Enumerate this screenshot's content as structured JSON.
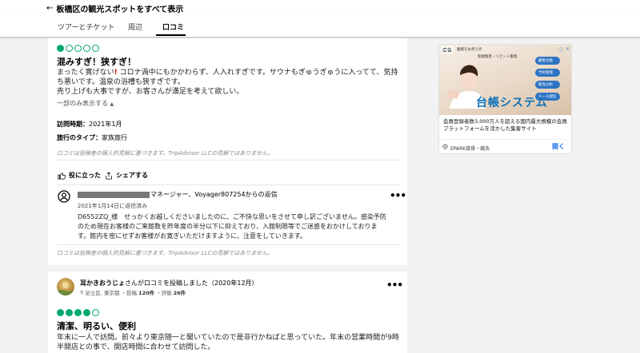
{
  "header": {
    "back_label": "板橋区の観光スポットをすべて表示"
  },
  "tabs": [
    {
      "label": "ツアーとチケット",
      "active": false
    },
    {
      "label": "周辺",
      "active": false
    },
    {
      "label": "口コミ",
      "active": true
    }
  ],
  "review1": {
    "rating": 1,
    "title": "混みすぎ！狭すぎ！",
    "body_lines": [
      "まったく寛げない",
      "コロナ渦中にもかかわらず、人入れすぎです。サウナもぎゅうぎゅうに入ってて、気持",
      "ち悪いです。温泉の浴槽も狭すぎです。",
      "売り上げも大事ですが、お客さんが満足を考えて欲しい。"
    ],
    "show_less": "一部のみ表示する",
    "visit_label": "訪問時期：",
    "visit_value": "2021年1月",
    "trip_label": "旅行のタイプ：",
    "trip_value": "家族旅行",
    "disclaimer": "口コミは投稿者の個人的見解に基づきます。TripAdvisor LLCの見解ではありません。",
    "helpful": "役に立った",
    "share": "シェアする"
  },
  "response": {
    "title_suffix": "マネージャー、Voyager807254からの返信",
    "date": "2021年1月14日に返信済み",
    "body_lines": [
      "D6552ZQ_様　せっかくお越しくださいましたのに、ご不快な思いをさせて申し訳ございません。感染予防",
      "のため現在お客様のご来館数を昨年度の半分以下に抑えており、入館制限等でご迷惑をおかけしておりま",
      "す。館内を密にせずお客様がお寛ぎいただけますように、注意をしていきます。"
    ],
    "disclaimer": "口コミは投稿者の個人的見解に基づきます。TripAdvisor LLCの見解ではありません。"
  },
  "review2": {
    "user": "耳かきおうじょ",
    "action": "さんが口コミを投稿しました（2020年12月）",
    "location": "足立区, 東京都",
    "posts_label": "・投稿",
    "posts": "120件",
    "votes_label": "・評価",
    "votes": "26件",
    "rating": 4,
    "title": "清潔、明るい、便利",
    "body_lines": [
      "年末に一人で訪問。前々より東京随一と聞いていたので是非行かねばと思っていた。年末の営業時間が9時",
      "半開店との事で、開店時間に合わせて訪問した。"
    ]
  },
  "ad": {
    "label": "広告",
    "small_text": "圏業をお考えの",
    "small_text2": "新規集客・リピート集客",
    "big_text": "台帳システム",
    "pills": [
      "顧客台帳",
      "予約管理",
      "販売分析",
      "メール配信"
    ],
    "desc_lines": [
      "会員登録者数3,000万人を超える国内最大規模の会員",
      "プラットフォームを活かした集客サイト"
    ],
    "source": "EPARK接骨・鍼灸",
    "open": "開く"
  }
}
